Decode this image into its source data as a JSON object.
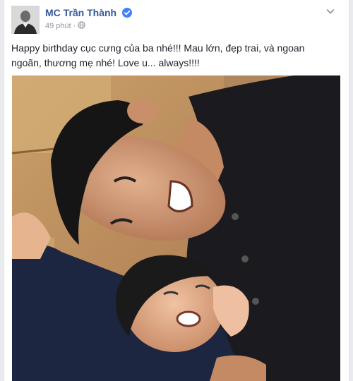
{
  "post": {
    "author": "MC Trần Thành",
    "timestamp": "49 phút",
    "separator": "·",
    "privacy_icon": "globe-icon",
    "verified_icon": "verified-badge-icon",
    "menu_icon": "chevron-down-icon",
    "text": "Happy birthday cục cưng của ba nhé!!! Mau lớn, đẹp trai, và ngoan ngoãn, thương mẹ nhé! Love u... always!!!!"
  },
  "colors": {
    "author_link": "#365899",
    "verified": "#4080ff",
    "meta_text": "#90949c",
    "body_text": "#1d2129"
  }
}
